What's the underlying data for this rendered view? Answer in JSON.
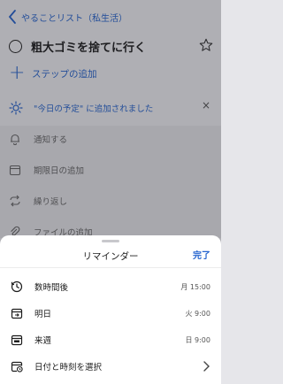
{
  "header": {
    "back_label": "やることリスト（私生活）"
  },
  "task": {
    "title": "粗大ゴミを捨てに行く"
  },
  "add_step": {
    "label": "ステップの追加"
  },
  "my_day_banner": {
    "text": "\"今日の予定\" に追加されました",
    "close": "×"
  },
  "options": [
    {
      "label": "通知する"
    },
    {
      "label": "期限日の追加"
    },
    {
      "label": "繰り返し"
    },
    {
      "label": "ファイルの追加"
    }
  ],
  "reminder_sheet": {
    "title": "リマインダー",
    "done_label": "完了",
    "items": [
      {
        "label": "数時間後",
        "value": "月 15:00"
      },
      {
        "label": "明日",
        "value": "火 9:00"
      },
      {
        "label": "来週",
        "value": "日 9:00"
      },
      {
        "label": "日付と時刻を選択",
        "value": ""
      }
    ]
  },
  "colors": {
    "accent": "#2564cf",
    "text": "#1c1c1c"
  }
}
